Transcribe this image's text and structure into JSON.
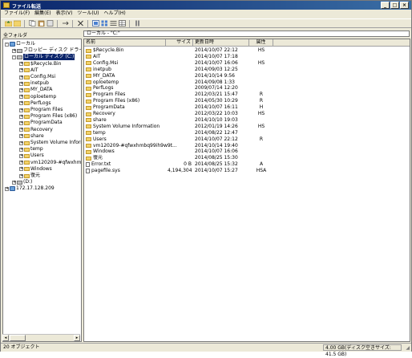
{
  "window": {
    "title": "ファイル転送",
    "min_label": "_",
    "max_label": "□",
    "close_label": "×"
  },
  "menu": [
    "ファイル(F)",
    "編集(E)",
    "表示(V)",
    "ツール(U)",
    "ヘルプ(H)"
  ],
  "toolbar": {
    "icons": [
      "folder-up-icon",
      "open-folder-icon",
      "copy-icon",
      "paste-icon",
      "properties-icon",
      "refresh-icon",
      "delete-icon",
      "large-icons-view-icon",
      "small-icons-view-icon",
      "list-view-icon",
      "details-view-icon",
      "options-icon"
    ]
  },
  "left_label": "全フォルダ",
  "path": "ローカル - \"C:\"",
  "tree": [
    {
      "label": "ローカル",
      "type": "net",
      "pm": "-",
      "indent": 0
    },
    {
      "label": "フロッピー ディスク ドライブ (A:)",
      "type": "drive",
      "pm": "+",
      "indent": 1
    },
    {
      "label": "ローカル ディスク (C:)",
      "type": "drive",
      "pm": "-",
      "indent": 1,
      "selected": true
    },
    {
      "label": "$Recycle.Bin",
      "type": "folder",
      "pm": "+",
      "indent": 2
    },
    {
      "label": "AIT",
      "type": "folder",
      "pm": "+",
      "indent": 2
    },
    {
      "label": "Config.Msi",
      "type": "folder",
      "pm": "+",
      "indent": 2
    },
    {
      "label": "inetpub",
      "type": "folder",
      "pm": "+",
      "indent": 2
    },
    {
      "label": "MY_DATA",
      "type": "folder",
      "pm": "+",
      "indent": 2
    },
    {
      "label": "oploetemp",
      "type": "folder",
      "pm": "+",
      "indent": 2
    },
    {
      "label": "PerfLogs",
      "type": "folder",
      "pm": "+",
      "indent": 2
    },
    {
      "label": "Program Files",
      "type": "folder",
      "pm": "+",
      "indent": 2
    },
    {
      "label": "Program Files (x86)",
      "type": "folder",
      "pm": "+",
      "indent": 2
    },
    {
      "label": "ProgramData",
      "type": "folder",
      "pm": "+",
      "indent": 2
    },
    {
      "label": "Recovery",
      "type": "folder",
      "pm": "+",
      "indent": 2
    },
    {
      "label": "share",
      "type": "folder",
      "pm": "+",
      "indent": 2
    },
    {
      "label": "System Volume Informa",
      "type": "folder",
      "pm": "+",
      "indent": 2
    },
    {
      "label": "temp",
      "type": "folder",
      "pm": "+",
      "indent": 2
    },
    {
      "label": "Users",
      "type": "folder",
      "pm": "+",
      "indent": 2
    },
    {
      "label": "vm120209-#qfwxhmbq",
      "type": "folder",
      "pm": "+",
      "indent": 2
    },
    {
      "label": "Windows",
      "type": "folder",
      "pm": "+",
      "indent": 2
    },
    {
      "label": "復元",
      "type": "folder",
      "pm": "+",
      "indent": 2
    },
    {
      "label": "(D:)",
      "type": "drive",
      "pm": "+",
      "indent": 1
    },
    {
      "label": "172.17.128.209",
      "type": "net",
      "pm": "+",
      "indent": 0
    }
  ],
  "columns": {
    "name": "名前",
    "size": "サイズ",
    "date": "更新日時",
    "attr": "属性"
  },
  "files": [
    {
      "name": "$Recycle.Bin",
      "size": "",
      "date": "2014/10/07 22:12",
      "attr": "HS",
      "type": "folder"
    },
    {
      "name": "AIT",
      "size": "",
      "date": "2014/10/07 17:18",
      "attr": "",
      "type": "folder"
    },
    {
      "name": "Config.Msi",
      "size": "",
      "date": "2014/10/07 16:06",
      "attr": "HS",
      "type": "folder"
    },
    {
      "name": "inetpub",
      "size": "",
      "date": "2014/09/03 12:25",
      "attr": "",
      "type": "folder"
    },
    {
      "name": "MY_DATA",
      "size": "",
      "date": "2014/10/14 9:56",
      "attr": "",
      "type": "folder"
    },
    {
      "name": "oploetemp",
      "size": "",
      "date": "2014/09/08 1:33",
      "attr": "",
      "type": "folder"
    },
    {
      "name": "PerfLogs",
      "size": "",
      "date": "2009/07/14 12:20",
      "attr": "",
      "type": "folder"
    },
    {
      "name": "Program Files",
      "size": "",
      "date": "2012/03/21 15:47",
      "attr": "R",
      "type": "folder"
    },
    {
      "name": "Program Files (x86)",
      "size": "",
      "date": "2014/05/30 10:29",
      "attr": "R",
      "type": "folder"
    },
    {
      "name": "ProgramData",
      "size": "",
      "date": "2014/10/07 16:11",
      "attr": "H",
      "type": "folder"
    },
    {
      "name": "Recovery",
      "size": "",
      "date": "2012/03/22 10:03",
      "attr": "HS",
      "type": "folder"
    },
    {
      "name": "share",
      "size": "",
      "date": "2014/10/10 19:03",
      "attr": "",
      "type": "folder"
    },
    {
      "name": "System Volume Information",
      "size": "",
      "date": "2012/01/19 14:26",
      "attr": "HS",
      "type": "folder"
    },
    {
      "name": "temp",
      "size": "",
      "date": "2014/08/22 12:47",
      "attr": "",
      "type": "folder"
    },
    {
      "name": "Users",
      "size": "",
      "date": "2014/10/07 22:12",
      "attr": "R",
      "type": "folder"
    },
    {
      "name": "vm120209-#qfwxhmbq99ih9w9t...",
      "size": "",
      "date": "2014/10/14 19:40",
      "attr": "",
      "type": "folder"
    },
    {
      "name": "Windows",
      "size": "",
      "date": "2014/10/07 16:06",
      "attr": "",
      "type": "folder"
    },
    {
      "name": "復元",
      "size": "",
      "date": "2014/08/25 15:30",
      "attr": "",
      "type": "folder"
    },
    {
      "name": "Error.txt",
      "size": "0 B",
      "date": "2014/08/25 15:32",
      "attr": "A",
      "type": "file"
    },
    {
      "name": "pagefile.sys",
      "size": "4,194,304 K...",
      "date": "2014/10/07 15:27",
      "attr": "HSA",
      "type": "file"
    }
  ],
  "status": {
    "count": "20 オブジェクト",
    "disk": "4.00 GB(ディスク空きサイズ: 41.5 GB)"
  }
}
